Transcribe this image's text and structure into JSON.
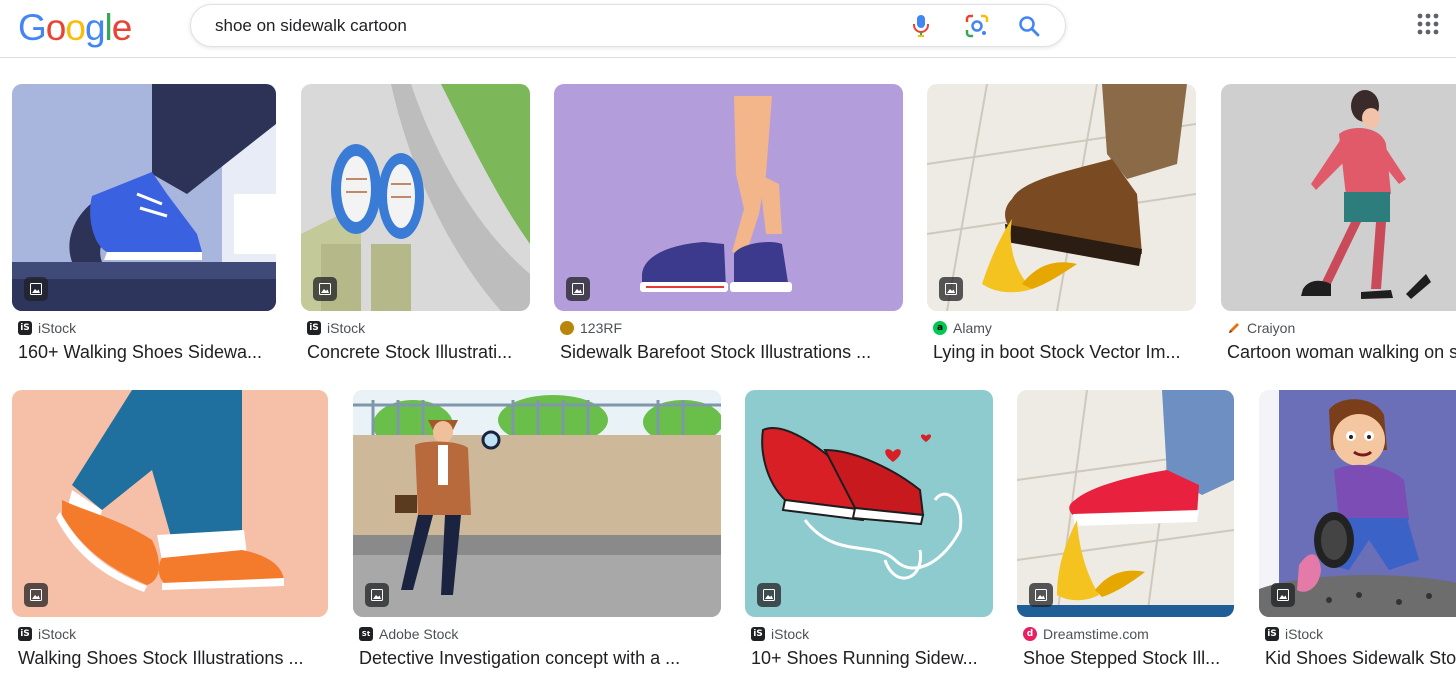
{
  "logo": {
    "letters": [
      "G",
      "o",
      "o",
      "g",
      "l",
      "e"
    ],
    "colors": [
      "#4285F4",
      "#EA4335",
      "#FBBC05",
      "#4285F4",
      "#34A853",
      "#EA4335"
    ]
  },
  "search": {
    "query": "shoe on sidewalk cartoon"
  },
  "icons": {
    "mic": "microphone-icon",
    "lens": "google-lens-icon",
    "search": "search-icon",
    "apps": "apps-grid-icon",
    "image_badge": "image-icon"
  },
  "results": [
    {
      "source": "iStock",
      "title": "160+ Walking Shoes Sidewa...",
      "favicon": "iS",
      "favicon_color": "#202124"
    },
    {
      "source": "iStock",
      "title": "Concrete Stock Illustrati...",
      "favicon": "iS",
      "favicon_color": "#202124"
    },
    {
      "source": "123RF",
      "title": "Sidewalk Barefoot Stock Illustrations ...",
      "favicon": "",
      "favicon_color": "#b8860b"
    },
    {
      "source": "Alamy",
      "title": "Lying in boot Stock Vector Im...",
      "favicon": "a",
      "favicon_color": "#00c853"
    },
    {
      "source": "Craiyon",
      "title": "Cartoon woman walking on s",
      "favicon": "",
      "favicon_color": "#e8710a"
    },
    {
      "source": "iStock",
      "title": "Walking Shoes Stock Illustrations ...",
      "favicon": "iS",
      "favicon_color": "#202124"
    },
    {
      "source": "Adobe Stock",
      "title": "Detective Investigation concept with a ...",
      "favicon": "St",
      "favicon_color": "#202124"
    },
    {
      "source": "iStock",
      "title": "10+ Shoes Running Sidew...",
      "favicon": "iS",
      "favicon_color": "#202124"
    },
    {
      "source": "Dreamstime.com",
      "title": "Shoe Stepped Stock Ill...",
      "favicon": "d",
      "favicon_color": "#e91e63"
    },
    {
      "source": "iStock",
      "title": "Kid Shoes Sidewalk Sto",
      "favicon": "iS",
      "favicon_color": "#202124"
    }
  ]
}
